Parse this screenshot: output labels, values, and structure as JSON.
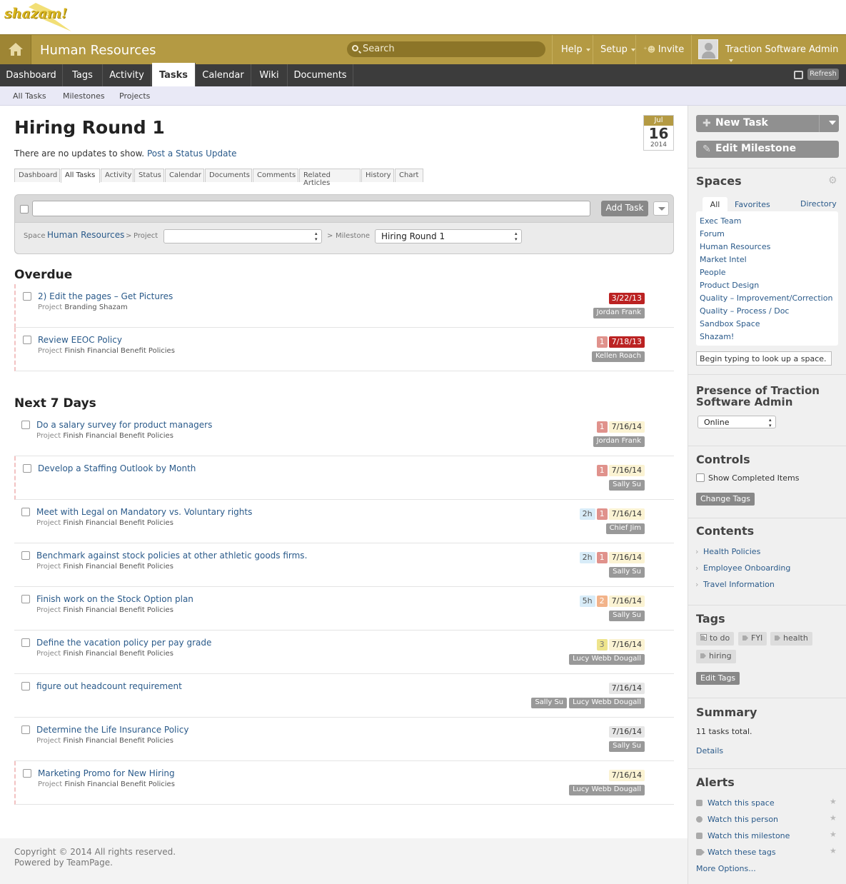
{
  "logo": {
    "text": "shazam!"
  },
  "topbar": {
    "space_title": "Human Resources",
    "search_placeholder": "Search",
    "help": "Help",
    "setup": "Setup",
    "invite": "Invite",
    "user": "Traction Software Admin"
  },
  "tabs": [
    "Dashboard",
    "Tags",
    "Activity",
    "Tasks",
    "Calendar",
    "Wiki",
    "Documents"
  ],
  "active_tab": "Tasks",
  "refresh": "Refresh",
  "subnav": [
    "All Tasks",
    "Milestones",
    "Projects"
  ],
  "page": {
    "title": "Hiring Round 1",
    "no_updates": "There are no updates to show.",
    "post_status": "Post a Status Update",
    "calendar": {
      "month": "Jul",
      "day": "16",
      "year": "2014"
    },
    "tabs": [
      "Dashboard",
      "All Tasks",
      "Activity",
      "Status",
      "Calendar",
      "Documents",
      "Comments",
      "Related Articles",
      "History",
      "Chart"
    ]
  },
  "toolbox": {
    "add_task": "Add Task",
    "space_label": "Space",
    "space_value": "Human Resources",
    "project_label": "Project",
    "milestone_label": "Milestone",
    "milestone_value": "Hiring Round 1",
    "arrow": ">"
  },
  "sections": {
    "overdue": "Overdue",
    "next7": "Next 7 Days"
  },
  "project_label": "Project",
  "overdue_tasks": [
    {
      "title": "2) Edit the pages – Get Pictures",
      "project": "Branding Shazam",
      "badges": [
        {
          "text": "3/22/13",
          "kind": "red"
        }
      ],
      "people": [
        "Jordan Frank"
      ]
    },
    {
      "title": "Review EEOC Policy",
      "project": "Finish Financial Benefit Policies",
      "badges": [
        {
          "text": "1",
          "kind": "pri1"
        },
        {
          "text": "7/18/13",
          "kind": "red"
        }
      ],
      "people": [
        "Kellen Roach"
      ]
    }
  ],
  "next7_tasks": [
    {
      "title": "Do a salary survey for product managers",
      "project": "Finish Financial Benefit Policies",
      "badges": [
        {
          "text": "1",
          "kind": "pri1"
        },
        {
          "text": "7/16/14",
          "kind": "date"
        }
      ],
      "people": [
        "Jordan Frank"
      ],
      "od": false
    },
    {
      "title": "Develop a Staffing Outlook by Month",
      "project": "",
      "badges": [
        {
          "text": "1",
          "kind": "pri1"
        },
        {
          "text": "7/16/14",
          "kind": "date"
        }
      ],
      "people": [
        "Sally Su"
      ],
      "od": true
    },
    {
      "title": "Meet with Legal on Mandatory vs. Voluntary rights",
      "project": "Finish Financial Benefit Policies",
      "badges": [
        {
          "text": "2h",
          "kind": "hr"
        },
        {
          "text": "1",
          "kind": "pri1"
        },
        {
          "text": "7/16/14",
          "kind": "date"
        }
      ],
      "people": [
        "Chief Jim"
      ],
      "od": false
    },
    {
      "title": "Benchmark against stock policies at other athletic goods firms.",
      "project": "Finish Financial Benefit Policies",
      "badges": [
        {
          "text": "2h",
          "kind": "hr"
        },
        {
          "text": "1",
          "kind": "pri1"
        },
        {
          "text": "7/16/14",
          "kind": "date"
        }
      ],
      "people": [
        "Sally Su"
      ],
      "od": false
    },
    {
      "title": "Finish work on the Stock Option plan",
      "project": "Finish Financial Benefit Policies",
      "badges": [
        {
          "text": "5h",
          "kind": "hr"
        },
        {
          "text": "2",
          "kind": "pri2"
        },
        {
          "text": "7/16/14",
          "kind": "date"
        }
      ],
      "people": [
        "Sally Su"
      ],
      "od": false
    },
    {
      "title": "Define the vacation policy per pay grade",
      "project": "Finish Financial Benefit Policies",
      "badges": [
        {
          "text": "3",
          "kind": "pri3"
        },
        {
          "text": "7/16/14",
          "kind": "date"
        }
      ],
      "people": [
        "Lucy Webb Dougall"
      ],
      "od": false
    },
    {
      "title": "figure out headcount requirement",
      "project": "",
      "badges": [
        {
          "text": "7/16/14",
          "kind": "gray"
        }
      ],
      "people": [
        "Sally Su",
        "Lucy Webb Dougall"
      ],
      "od": false
    },
    {
      "title": "Determine the Life Insurance Policy",
      "project": "Finish Financial Benefit Policies",
      "badges": [
        {
          "text": "7/16/14",
          "kind": "gray"
        }
      ],
      "people": [
        "Sally Su"
      ],
      "od": false
    },
    {
      "title": "Marketing Promo for New Hiring",
      "project": "Finish Financial Benefit Policies",
      "badges": [
        {
          "text": "7/16/14",
          "kind": "date"
        }
      ],
      "people": [
        "Lucy Webb Dougall"
      ],
      "od": true
    }
  ],
  "footer": {
    "copyright": "Copyright © 2014 All rights reserved.",
    "powered": "Powered by TeamPage."
  },
  "sidebar": {
    "new_task": "New Task",
    "edit_milestone": "Edit Milestone",
    "spaces_title": "Spaces",
    "spaces_tabs": [
      "All",
      "Favorites",
      "Directory"
    ],
    "spaces": [
      "Exec Team",
      "Forum",
      "Human Resources",
      "Market Intel",
      "People",
      "Product Design",
      "Quality – Improvement/Correction",
      "Quality – Process / Doc",
      "Sandbox Space",
      "Shazam!"
    ],
    "lookup_placeholder": "Begin typing to look up a space.",
    "presence_title": "Presence of Traction Software Admin",
    "presence_value": "Online",
    "controls_title": "Controls",
    "show_completed": "Show Completed Items",
    "change_tags": "Change Tags",
    "contents_title": "Contents",
    "contents": [
      "Health Policies",
      "Employee Onboarding",
      "Travel Information"
    ],
    "tags_title": "Tags",
    "tags": [
      "to do",
      "FYI",
      "health",
      "hiring"
    ],
    "edit_tags": "Edit Tags",
    "summary_title": "Summary",
    "summary_text": "11 tasks total.",
    "details": "Details",
    "alerts_title": "Alerts",
    "alerts": [
      "Watch this space",
      "Watch this person",
      "Watch this milestone",
      "Watch these tags"
    ],
    "more_options": "More Options..."
  }
}
